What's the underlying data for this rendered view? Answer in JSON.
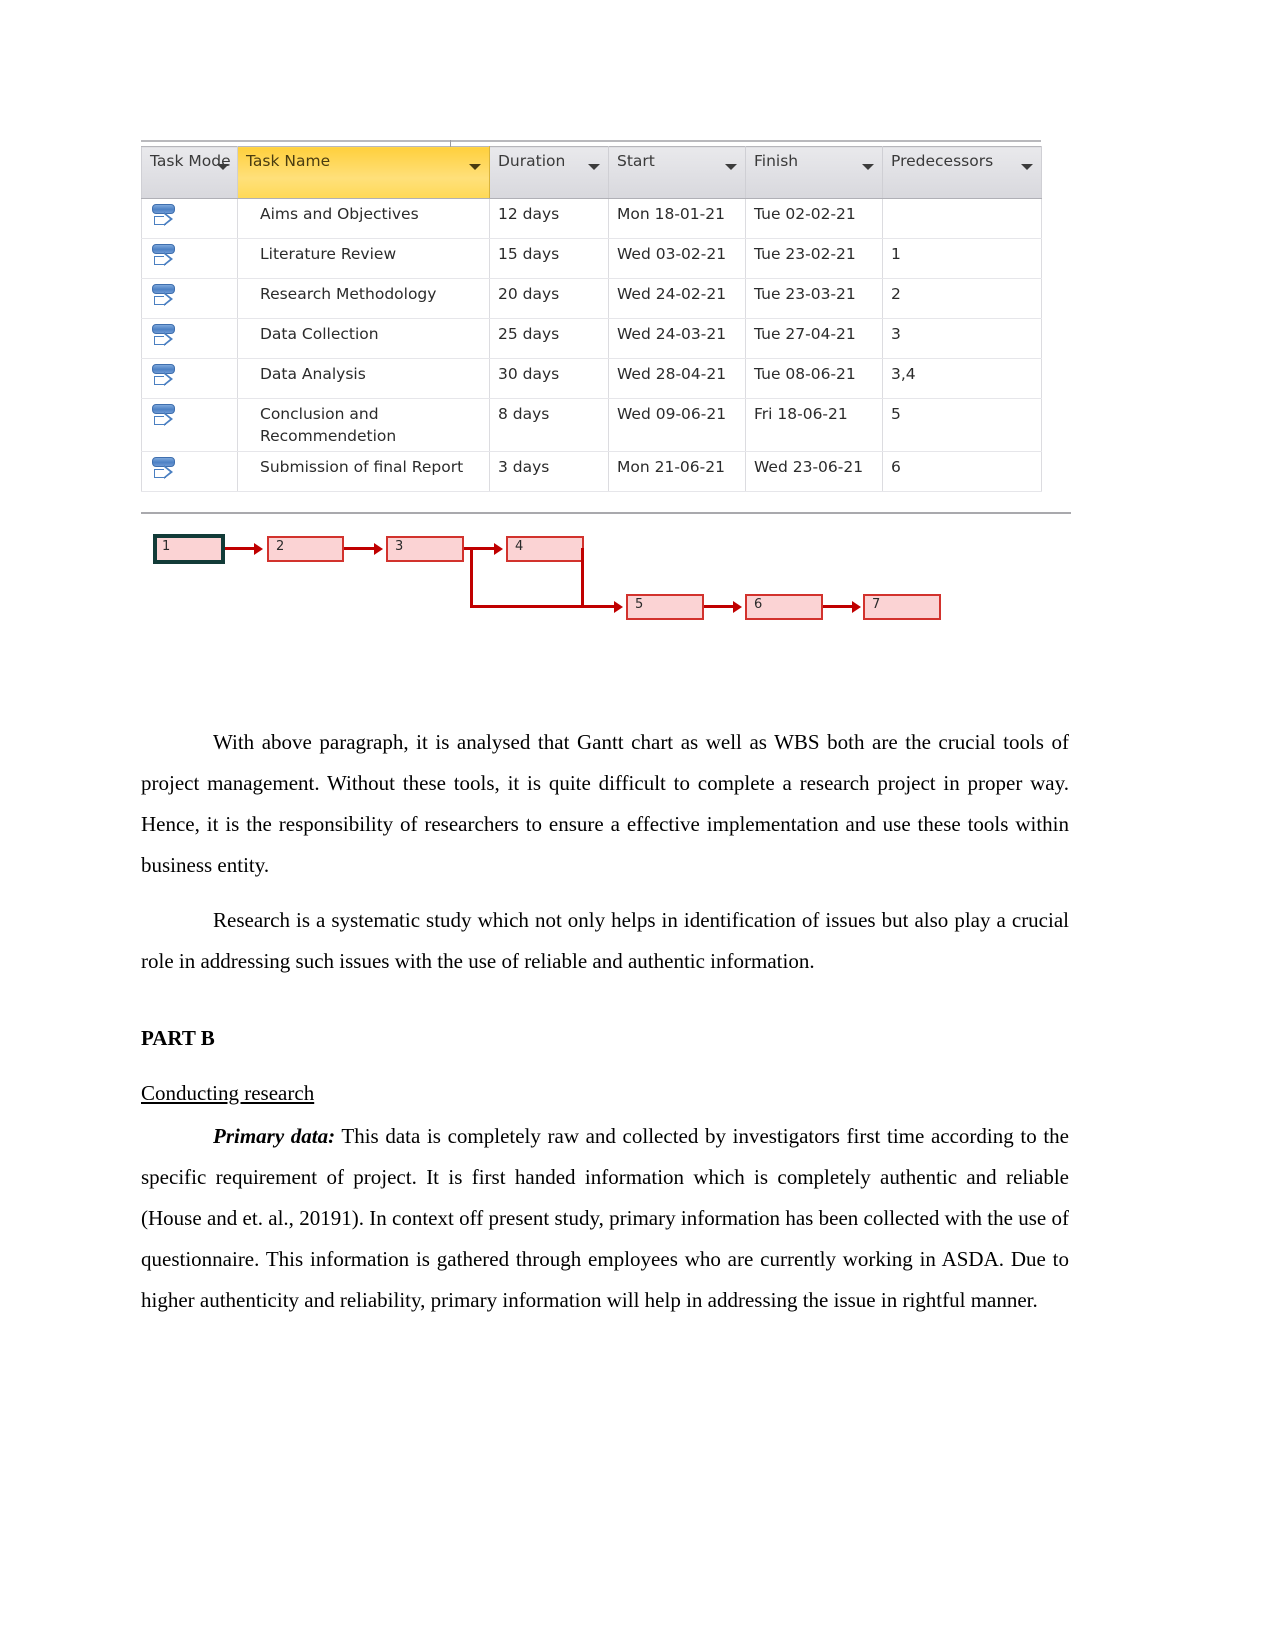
{
  "project_table": {
    "columns": [
      {
        "key": "mode",
        "label": "Task Mode"
      },
      {
        "key": "name",
        "label": "Task Name"
      },
      {
        "key": "duration",
        "label": "Duration"
      },
      {
        "key": "start",
        "label": "Start"
      },
      {
        "key": "finish",
        "label": "Finish"
      },
      {
        "key": "predecessors",
        "label": "Predecessors"
      }
    ],
    "rows": [
      {
        "mode_icon": "auto-schedule-icon",
        "name": "Aims and Objectives",
        "duration": "12 days",
        "start": "Mon 18-01-21",
        "finish": "Tue 02-02-21",
        "predecessors": ""
      },
      {
        "mode_icon": "auto-schedule-icon",
        "name": "Literature Review",
        "duration": "15 days",
        "start": "Wed 03-02-21",
        "finish": "Tue 23-02-21",
        "predecessors": "1"
      },
      {
        "mode_icon": "auto-schedule-icon",
        "name": "Research Methodology",
        "duration": "20 days",
        "start": "Wed 24-02-21",
        "finish": "Tue 23-03-21",
        "predecessors": "2"
      },
      {
        "mode_icon": "auto-schedule-icon",
        "name": "Data Collection",
        "duration": "25 days",
        "start": "Wed 24-03-21",
        "finish": "Tue 27-04-21",
        "predecessors": "3"
      },
      {
        "mode_icon": "auto-schedule-icon",
        "name": "Data Analysis",
        "duration": "30 days",
        "start": "Wed 28-04-21",
        "finish": "Tue 08-06-21",
        "predecessors": "3,4"
      },
      {
        "mode_icon": "auto-schedule-icon",
        "name": "Conclusion and Recommendetion",
        "duration": "8 days",
        "start": "Wed 09-06-21",
        "finish": "Fri 18-06-21",
        "predecessors": "5"
      },
      {
        "mode_icon": "auto-schedule-icon",
        "name": "Submission of final Report",
        "duration": "3 days",
        "start": "Mon 21-06-21",
        "finish": "Wed 23-06-21",
        "predecessors": "6"
      }
    ],
    "colors": {
      "header_background": "#dedee2",
      "taskname_header_background": "#ffd64a",
      "grid_line": "#cfcfd4",
      "icon_blue": "#4a7fc1"
    }
  },
  "network_diagram": {
    "nodes": [
      {
        "id": "1",
        "label": "1",
        "selected": true
      },
      {
        "id": "2",
        "label": "2",
        "selected": false
      },
      {
        "id": "3",
        "label": "3",
        "selected": false
      },
      {
        "id": "4",
        "label": "4",
        "selected": false
      },
      {
        "id": "5",
        "label": "5",
        "selected": false
      },
      {
        "id": "6",
        "label": "6",
        "selected": false
      },
      {
        "id": "7",
        "label": "7",
        "selected": false
      }
    ],
    "edges": [
      {
        "from": "1",
        "to": "2"
      },
      {
        "from": "2",
        "to": "3"
      },
      {
        "from": "3",
        "to": "4"
      },
      {
        "from": "3",
        "to": "5"
      },
      {
        "from": "4",
        "to": "5"
      },
      {
        "from": "5",
        "to": "6"
      },
      {
        "from": "6",
        "to": "7"
      }
    ],
    "colors": {
      "node_fill": "#fbd3d4",
      "node_border": "#d2322d",
      "connector": "#c00000",
      "selection_border": "#123b38"
    }
  },
  "document": {
    "paragraph_1": "With above paragraph, it is analysed that Gantt chart as well as WBS both are the crucial tools of project management. Without these tools, it is quite difficult to complete a research project in proper way. Hence, it is the responsibility of researchers to ensure a effective implementation and use these tools within business entity.",
    "paragraph_2": "Research is a systematic study which not only helps in identification of issues but also play a crucial role in addressing such issues with the use of reliable and authentic information.",
    "part_b_heading": "PART B",
    "conducting_research_heading": "Conducting research ",
    "primary_data_label": "Primary data:",
    "paragraph_3": "  This data is completely raw and collected by investigators first time according to the specific requirement of project. It is first handed information which is completely authentic and reliable (House and et. al., 20191). In context off present study, primary information has been collected with the use of questionnaire. This information is gathered through employees who are currently working in ASDA. Due to higher authenticity and reliability, primary information will help in addressing the issue in rightful manner."
  }
}
